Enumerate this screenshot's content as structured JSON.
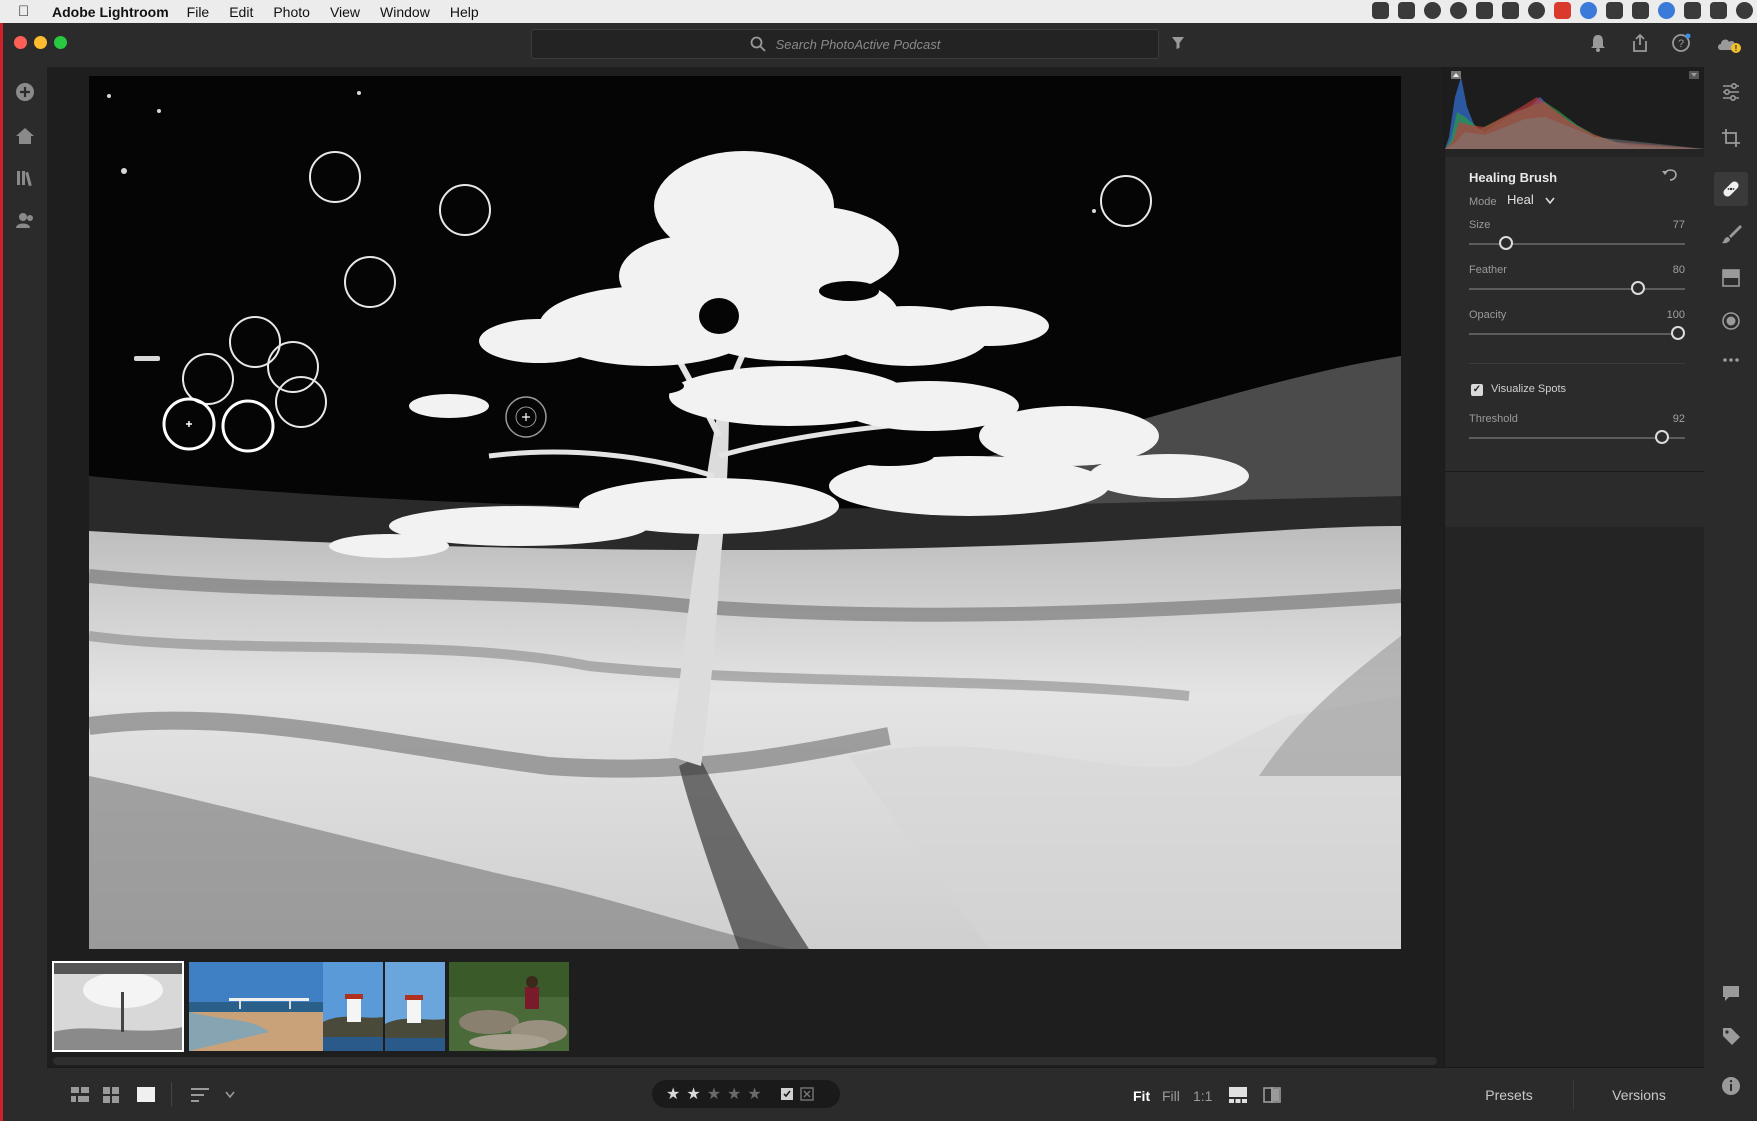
{
  "menubar": {
    "app_name": "Adobe Lightroom",
    "menus": [
      "File",
      "Edit",
      "Photo",
      "View",
      "Window",
      "Help"
    ]
  },
  "toolbar": {
    "search_placeholder": "Search PhotoActive Podcast"
  },
  "left_rail": {
    "icons": [
      "add-photos-icon",
      "home-icon",
      "library-icon",
      "people-icon"
    ]
  },
  "healing_panel": {
    "title": "Healing Brush",
    "mode_label": "Mode",
    "mode_value": "Heal",
    "sliders": [
      {
        "label": "Size",
        "value": "77",
        "fraction": 0.15
      },
      {
        "label": "Feather",
        "value": "80",
        "fraction": 0.8
      },
      {
        "label": "Opacity",
        "value": "100",
        "fraction": 1.0
      }
    ],
    "visualize_spots_label": "Visualize Spots",
    "visualize_spots_checked": true,
    "threshold_label": "Threshold",
    "threshold_value": "92",
    "threshold_fraction": 0.92
  },
  "filmstrip": {
    "thumbnails": [
      "thumb-tree-visualized",
      "thumb-beach-pier",
      "thumb-lighthouse-1",
      "thumb-lighthouse-2",
      "thumb-person-rocks"
    ],
    "selected_index": 0
  },
  "bottombar": {
    "view_icons": [
      "photo-grid-icon",
      "square-grid-icon",
      "detail-view-icon",
      "sort-icon"
    ],
    "rating": 2,
    "max_rating": 5,
    "zoom_options": [
      "Fit",
      "Fill",
      "1:1"
    ],
    "zoom_active": "Fit"
  },
  "panel_tabs": {
    "presets": "Presets",
    "versions": "Versions"
  },
  "right_rail": {
    "icons": [
      "edit-sliders-icon",
      "crop-icon",
      "healing-icon",
      "brush-icon",
      "linear-gradient-icon",
      "radial-gradient-icon",
      "more-icon",
      "comments-icon",
      "keywords-icon",
      "info-icon"
    ],
    "active": "healing-icon"
  },
  "colors": {
    "accent_red": "#d0202a",
    "panel_bg": "#2b2b2b",
    "canvas_bg": "#1e1e1e"
  }
}
